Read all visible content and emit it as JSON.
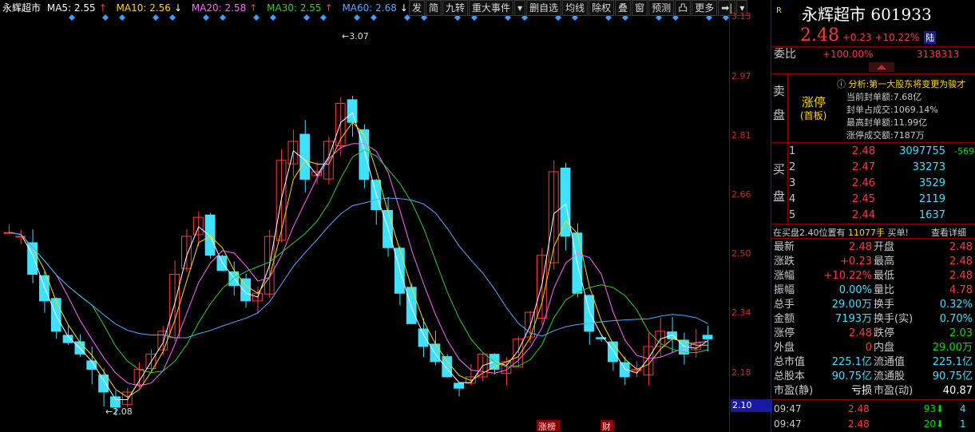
{
  "legend": {
    "stock_name": "永辉超市",
    "ma5": "MA5: 2.55",
    "ma5_arrow": "↑",
    "ma10": "MA10: 2.56",
    "ma10_arrow": "↓",
    "ma20": "MA20: 2.58",
    "ma20_arrow": "↑",
    "ma30": "MA30: 2.55",
    "ma30_arrow": "↑",
    "ma60": "MA60: 2.68",
    "ma60_arrow": "↓"
  },
  "toolbar": [
    "发",
    "简",
    "九转",
    "重大事件",
    "▾",
    "删自选",
    "均线",
    "除权",
    "叠",
    "窗",
    "预测",
    "凸",
    "更多",
    "➡|",
    "▾"
  ],
  "chart_annotations": {
    "high_label": "3.07",
    "low_label": "2.08",
    "event_tags": [
      "涨榜",
      "财"
    ]
  },
  "price_axis": {
    "labels": [
      "3.13",
      "2.97",
      "2.81",
      "2.66",
      "2.50",
      "2.34",
      "2.18"
    ],
    "current": "2.10"
  },
  "colors": {
    "up": "#ff3b3b",
    "down": "#40e0ff",
    "ma5": "#ffffff",
    "ma10": "#ffd700",
    "ma20": "#ff66ff",
    "ma30": "#33cc33",
    "ma60": "#55aaff"
  },
  "panel": {
    "logo": "R",
    "title": "永辉超市 601933",
    "price": "2.48",
    "change": "+0.23",
    "change_pct": "+10.22%",
    "lu": "陆",
    "weibi_label": "委比",
    "weibi_pct": "+100.00%",
    "weibi_vol": "3138313",
    "sell_label_top": "卖",
    "sell_label_bot": "盘",
    "limit_up": "涨停",
    "limit_up_sub": "(首板)",
    "analysis": "分析:第一大股东将变更为骏才",
    "seal_amount": "当前封单额:7.68亿",
    "seal_ratio": "封单占成交:1069.14%",
    "max_seal": "最高封单额:11.99亿",
    "limit_turnover": "涨停成交额:7187万",
    "buy_label_top": "买",
    "buy_label_bot": "盘",
    "buy_rows": [
      {
        "lvl": "1",
        "price": "2.48",
        "vol": "3097755",
        "delta": "-569"
      },
      {
        "lvl": "2",
        "price": "2.47",
        "vol": "33273",
        "delta": ""
      },
      {
        "lvl": "3",
        "price": "2.46",
        "vol": "3529",
        "delta": ""
      },
      {
        "lvl": "4",
        "price": "2.45",
        "vol": "2119",
        "delta": ""
      },
      {
        "lvl": "5",
        "price": "2.44",
        "vol": "1637",
        "delta": ""
      }
    ],
    "notice_prefix": "在买盘2.40位置有",
    "notice_vol": "11077手",
    "notice_suffix": "买单!",
    "notice_link": "查看详细",
    "stats": [
      {
        "l1": "最新",
        "v1": "2.48",
        "c1": "red",
        "l2": "开盘",
        "v2": "2.48",
        "c2": "red"
      },
      {
        "l1": "涨跌",
        "v1": "+0.23",
        "c1": "red",
        "l2": "最高",
        "v2": "2.48",
        "c2": "red"
      },
      {
        "l1": "涨幅",
        "v1": "+10.22%",
        "c1": "red",
        "l2": "最低",
        "v2": "2.48",
        "c2": "red"
      },
      {
        "l1": "振幅",
        "v1": "0.00%",
        "c1": "cyan",
        "l2": "量比",
        "v2": "4.78",
        "c2": "red"
      },
      {
        "l1": "总手",
        "v1": "29.00万",
        "c1": "cyan",
        "l2": "换手",
        "v2": "0.32%",
        "c2": "cyan"
      },
      {
        "l1": "金额",
        "v1": "7193万",
        "c1": "cyan",
        "l2": "换手(实)",
        "v2": "0.70%",
        "c2": "cyan"
      },
      {
        "l1": "涨停",
        "v1": "2.48",
        "c1": "red",
        "l2": "跌停",
        "v2": "2.03",
        "c2": "green"
      },
      {
        "l1": "外盘",
        "v1": "0",
        "c1": "red",
        "l2": "内盘",
        "v2": "29.00万",
        "c2": "green"
      },
      {
        "l1": "总市值",
        "v1": "225.1亿",
        "c1": "cyan",
        "l2": "流通值",
        "v2": "225.1亿",
        "c2": "cyan"
      },
      {
        "l1": "总股本",
        "v1": "90.75亿",
        "c1": "cyan",
        "l2": "流通股",
        "v2": "90.75亿",
        "c2": "cyan"
      },
      {
        "l1": "市盈(静)",
        "v1": "亏损",
        "c1": "white",
        "l2": "市盈(动)",
        "v2": "40.87",
        "c2": "white"
      }
    ],
    "ticks": [
      {
        "time": "09:47",
        "price": "2.48",
        "vol": "93",
        "arrow": "⬇",
        "n": "4"
      },
      {
        "time": "09:47",
        "price": "2.48",
        "vol": "20",
        "arrow": "⬇",
        "n": "1"
      }
    ]
  }
}
